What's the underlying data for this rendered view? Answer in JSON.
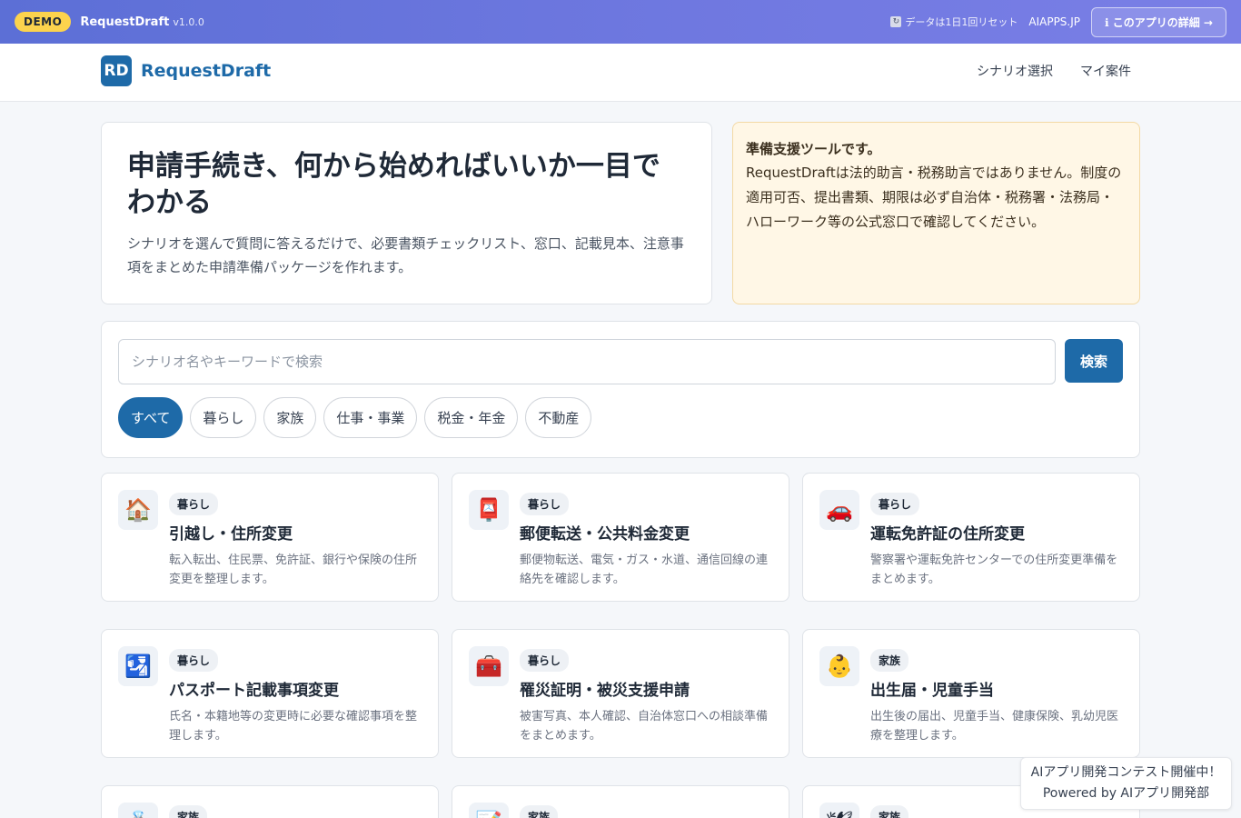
{
  "demo_bar": {
    "badge": "DEMO",
    "app_name": "RequestDraft",
    "version": "v1.0.0",
    "reset_note": "データは1日1回リセット",
    "site": "AIAPPS.JP",
    "detail_button": "ℹ このアプリの詳細 →"
  },
  "header": {
    "logo_mark": "RD",
    "logo_text": "RequestDraft",
    "nav": [
      "シナリオ選択",
      "マイ案件"
    ]
  },
  "hero": {
    "title": "申請手続き、何から始めればいいか一目でわかる",
    "subtitle": "シナリオを選んで質問に答えるだけで、必要書類チェックリスト、窓口、記載見本、注意事項をまとめた申請準備パッケージを作れます。"
  },
  "notice": {
    "title": "準備支援ツールです。",
    "body": "RequestDraftは法的助言・税務助言ではありません。制度の適用可否、提出書類、期限は必ず自治体・税務署・法務局・ハローワーク等の公式窓口で確認してください。"
  },
  "search": {
    "placeholder": "シナリオ名やキーワードで検索",
    "button": "検索",
    "chips": [
      "すべて",
      "暮らし",
      "家族",
      "仕事・事業",
      "税金・年金",
      "不動産"
    ],
    "active_chip": "すべて"
  },
  "cards": [
    {
      "icon": "🏠",
      "icon_name": "house-icon",
      "tag": "暮らし",
      "title": "引越し・住所変更",
      "desc": "転入転出、住民票、免許証、銀行や保険の住所変更を整理します。"
    },
    {
      "icon": "📮",
      "icon_name": "postbox-icon",
      "tag": "暮らし",
      "title": "郵便転送・公共料金変更",
      "desc": "郵便物転送、電気・ガス・水道、通信回線の連絡先を確認します。"
    },
    {
      "icon": "🚗",
      "icon_name": "car-icon",
      "tag": "暮らし",
      "title": "運転免許証の住所変更",
      "desc": "警察署や運転免許センターでの住所変更準備をまとめます。"
    },
    {
      "icon": "🛂",
      "icon_name": "passport-control-icon",
      "tag": "暮らし",
      "title": "パスポート記載事項変更",
      "desc": "氏名・本籍地等の変更時に必要な確認事項を整理します。"
    },
    {
      "icon": "🧰",
      "icon_name": "toolbox-icon",
      "tag": "暮らし",
      "title": "罹災証明・被災支援申請",
      "desc": "被害写真、本人確認、自治体窓口への相談準備をまとめます。"
    },
    {
      "icon": "👶",
      "icon_name": "baby-icon",
      "tag": "家族",
      "title": "出生届・児童手当",
      "desc": "出生後の届出、児童手当、健康保険、乳幼児医療を整理します。"
    },
    {
      "icon": "💍",
      "icon_name": "ring-icon",
      "tag": "家族",
      "title": "",
      "desc": ""
    },
    {
      "icon": "📝",
      "icon_name": "memo-icon",
      "tag": "家族",
      "title": "",
      "desc": ""
    },
    {
      "icon": "🕊",
      "icon_name": "dove-icon",
      "tag": "家族",
      "title": "",
      "desc": ""
    }
  ],
  "promo": {
    "line1": "AIアプリ開発コンテスト開催中！",
    "line2": "Powered by AIアプリ開発部"
  }
}
